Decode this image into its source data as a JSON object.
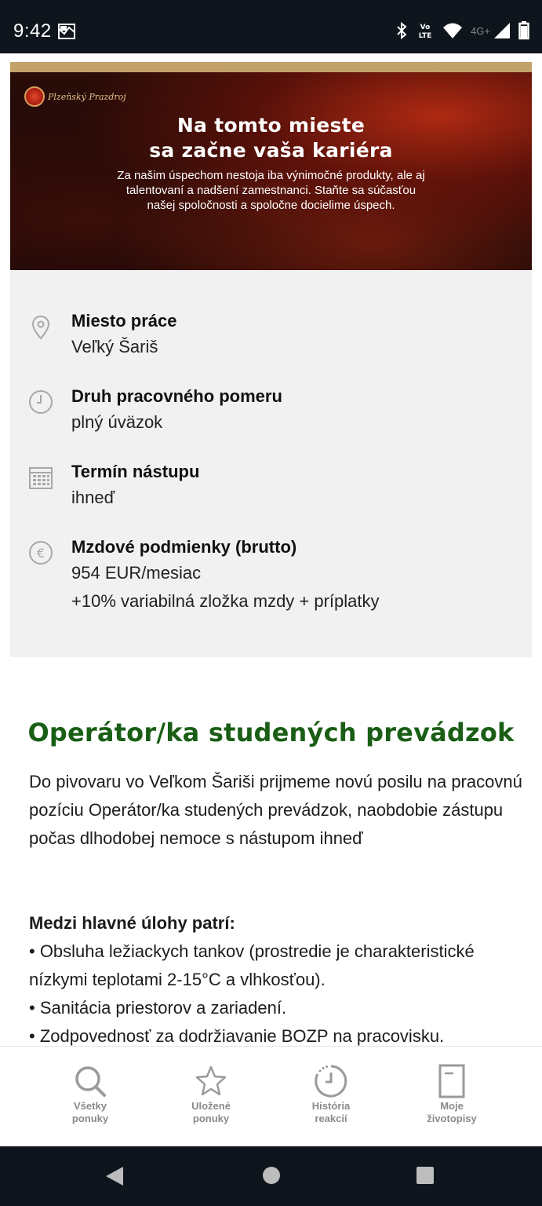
{
  "status_bar": {
    "time": "9:42",
    "network_label": "4G+",
    "volte_label": "Vo LTE",
    "icons": [
      "notification-icon",
      "bluetooth-icon",
      "volte-icon",
      "wifi-icon",
      "signal-icon",
      "battery-icon"
    ]
  },
  "banner": {
    "logo_text": "Plzeňský Prazdroj",
    "title_line1": "Na tomto mieste",
    "title_line2": "sa začne vaša kariéra",
    "subtitle": "Za našim úspechom nestoja iba výnimočné produkty, ale aj talentovaní a nadšení zamestnanci. Staňte sa súčasťou našej spoločnosti a spoločne docielime úspech."
  },
  "info": {
    "location": {
      "label": "Miesto práce",
      "value": "Veľký Šariš",
      "icon": "location-pin-icon"
    },
    "employment": {
      "label": "Druh pracovného pomeru",
      "value": "plný úväzok",
      "icon": "clock-icon"
    },
    "start": {
      "label": "Termín nástupu",
      "value": "ihneď",
      "icon": "calendar-icon"
    },
    "salary": {
      "label": "Mzdové podmienky (brutto)",
      "value_line1": "954 EUR/mesiac",
      "value_line2": "+10% variabilná zložka mzdy + príplatky",
      "icon": "euro-icon"
    }
  },
  "job": {
    "title": "Operátor/ka studených prevádzok",
    "intro": "Do pivovaru vo Veľkom Šariši prijmeme novú posilu na pracovnú pozíciu Operátor/ka studených prevádzok, naobdobie zástupu počas dlhodobej nemoce s nástupom ihneď",
    "tasks_heading": "Medzi hlavné úlohy patrí:",
    "tasks": [
      "• Obsluha ležiackych tankov (prostredie je charakteristické nízkymi teplotami 2-15°C a vlhkosťou).",
      "• Sanitácia priestorov a zariadení.",
      "• Zodpovednosť za dodržiavanie BOZP na pracovisku."
    ]
  },
  "bottom_nav": {
    "items": [
      {
        "line1": "Všetky",
        "line2": "ponuky",
        "icon": "search-icon"
      },
      {
        "line1": "Uložené",
        "line2": "ponuky",
        "icon": "star-icon"
      },
      {
        "line1": "História",
        "line2": "reakcií",
        "icon": "history-icon"
      },
      {
        "line1": "Moje",
        "line2": "životopisy",
        "icon": "document-icon"
      }
    ]
  },
  "system_nav": {
    "icons": [
      "back-icon",
      "home-icon",
      "recents-icon"
    ]
  },
  "colors": {
    "accent_green": "#1a5e16",
    "gold": "#c3a26a",
    "info_bg": "#f1f1f1",
    "status_bar_bg": "#0e151c",
    "nav_label": "#8a8a8a"
  }
}
